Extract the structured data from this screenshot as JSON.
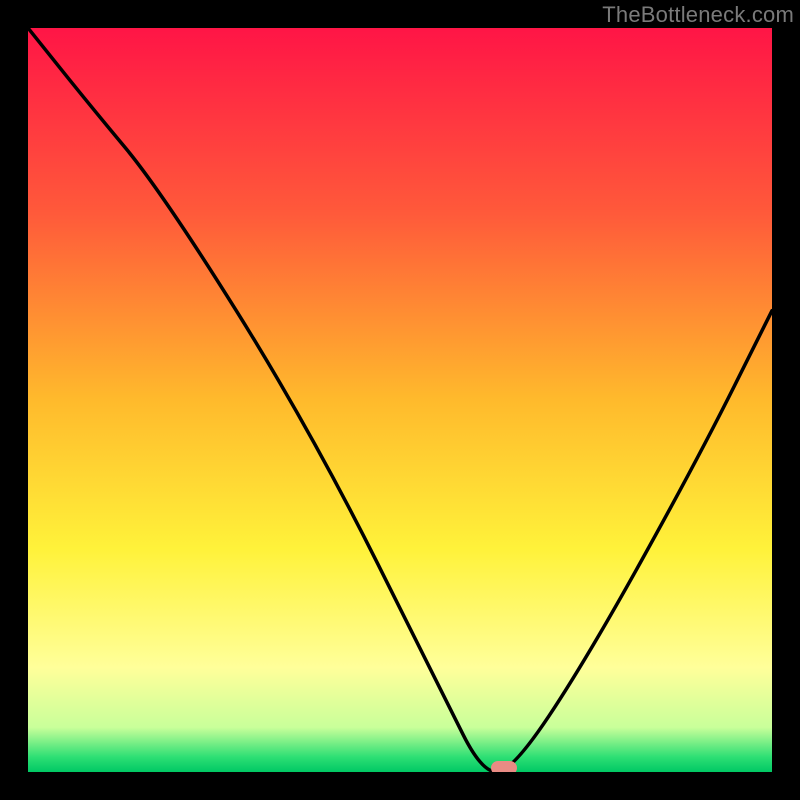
{
  "watermark": "TheBottleneck.com",
  "chart_data": {
    "type": "line",
    "title": "",
    "xlabel": "",
    "ylabel": "",
    "xlim": [
      0,
      100
    ],
    "ylim": [
      0,
      100
    ],
    "grid": false,
    "legend": false,
    "series": [
      {
        "name": "bottleneck-curve",
        "x": [
          0,
          8,
          18,
          38,
          56,
          61,
          65,
          75,
          90,
          100
        ],
        "y": [
          100,
          90,
          78,
          46,
          10,
          0,
          0,
          15,
          42,
          62
        ]
      }
    ],
    "marker": {
      "x": 64,
      "y": 0.5
    },
    "gradient_stops": [
      {
        "offset": 0,
        "color": "#ff1546"
      },
      {
        "offset": 25,
        "color": "#ff5a3a"
      },
      {
        "offset": 50,
        "color": "#ffba2c"
      },
      {
        "offset": 70,
        "color": "#fff23a"
      },
      {
        "offset": 86,
        "color": "#ffff9a"
      },
      {
        "offset": 94,
        "color": "#c9ff9a"
      },
      {
        "offset": 98,
        "color": "#2ddf74"
      },
      {
        "offset": 100,
        "color": "#00c864"
      }
    ]
  }
}
